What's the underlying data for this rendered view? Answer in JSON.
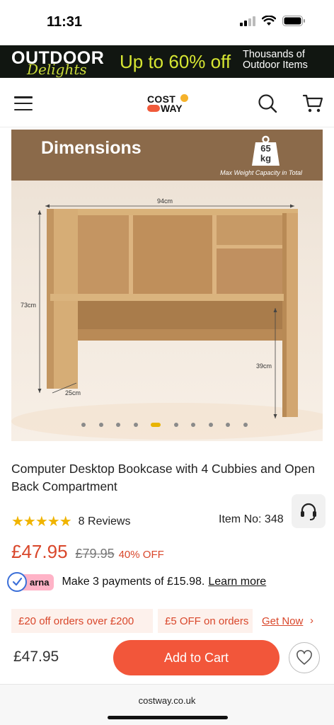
{
  "status_bar": {
    "time": "11:31"
  },
  "promo_banner": {
    "brand": "OUTDOOR",
    "brand_script": "Delights",
    "offer": "Up to 60% off",
    "subtext_line1": "Thousands of",
    "subtext_line2": "Outdoor Items"
  },
  "header": {
    "logo_line1": "COST",
    "logo_line2": "WAY",
    "menu_icon": "hamburger-menu-icon",
    "search_icon": "search-icon",
    "cart_icon": "cart-icon"
  },
  "product_image": {
    "title": "Dimensions",
    "weight_value": "65",
    "weight_unit": "kg",
    "weight_caption": "Max Weight Capacity in Total",
    "dim_width": "94cm",
    "dim_height": "73cm",
    "dim_depth": "25cm",
    "dim_inner_height": "39cm",
    "carousel": {
      "count": 10,
      "active_index": 4
    }
  },
  "product": {
    "title": "Computer Desktop Bookcase with 4 Cubbies and Open Back Compartment",
    "rating": 5,
    "stars": "★★★★★",
    "reviews_count": "8",
    "reviews_label": "Reviews",
    "item_no_label": "Item No:",
    "item_no_value": "348",
    "price": "£47.95",
    "was_price": "£79.95",
    "discount": "40% OFF"
  },
  "klarna": {
    "badge": "arna",
    "text": "Make 3 payments of £15.98.",
    "link": "Learn more"
  },
  "coupons": [
    {
      "text": "£20 off orders over £200"
    },
    {
      "text": "£5 OFF on orders"
    }
  ],
  "coupon_cta": "Get Now",
  "coupon_cta_arrow": "›",
  "bottom_bar": {
    "price": "£47.95",
    "add_to_cart": "Add to Cart"
  },
  "url_bar": {
    "url": "costway.co.uk"
  },
  "colors": {
    "accent": "#f2563a",
    "price": "#d9472b",
    "star": "#f0b400",
    "promo_bg": "#111611",
    "promo_text": "#d6e632",
    "image_header": "#8b6a4a",
    "klarna_pink": "#ffb3c7"
  }
}
